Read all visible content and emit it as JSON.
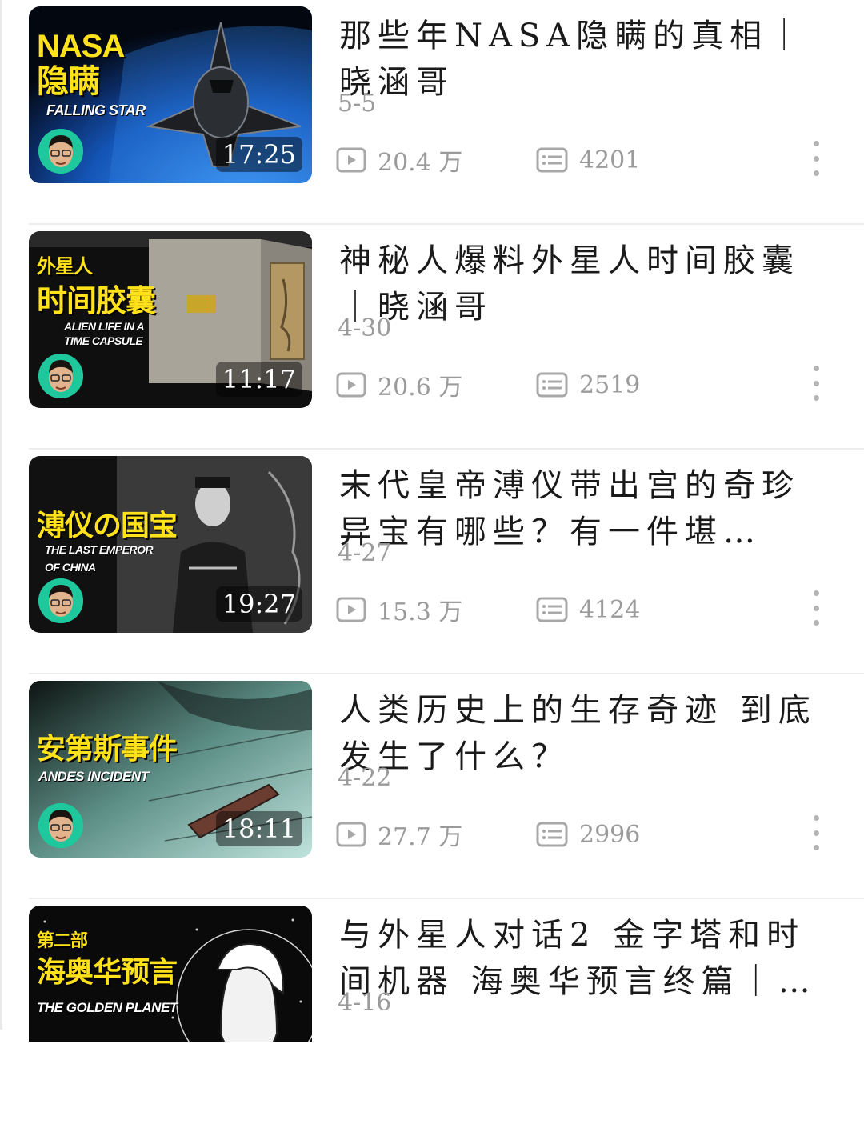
{
  "videos": [
    {
      "title": "那些年NASA隐瞒的真相｜晓涵哥",
      "date": "5-5",
      "views": "20.4 万",
      "comments": "4201",
      "duration": "17:25",
      "thumb_cn": "NASA\n隐瞒",
      "thumb_en": "FALLING STAR"
    },
    {
      "title": "神秘人爆料外星人时间胶囊｜晓涵哥",
      "date": "4-30",
      "views": "20.6 万",
      "comments": "2519",
      "duration": "11:17",
      "thumb_cn_small": "外星人",
      "thumb_cn": "时间胶囊",
      "thumb_en": "ALIEN LIFE IN A\nTIME CAPSULE"
    },
    {
      "title": "末代皇帝溥仪带出宫的奇珍异宝有哪些？有一件堪…",
      "date": "4-27",
      "views": "15.3 万",
      "comments": "4124",
      "duration": "19:27",
      "thumb_cn": "溥仪の国宝",
      "thumb_en": "THE LAST EMPEROR\nOF CHINA"
    },
    {
      "title": "人类历史上的生存奇迹 到底发生了什么？",
      "date": "4-22",
      "views": "27.7 万",
      "comments": "2996",
      "duration": "18:11",
      "thumb_cn": "安第斯事件",
      "thumb_en": "ANDES INCIDENT"
    },
    {
      "title": "与外星人对话2 金字塔和时间机器 海奥华预言终篇｜…",
      "date": "4-16",
      "thumb_cn_small": "第二部",
      "thumb_cn": "海奥华预言",
      "thumb_en": "THE GOLDEN PLANET"
    }
  ],
  "icons": {
    "views": "play-icon",
    "comments": "comment-icon",
    "more": "more-vertical-icon"
  },
  "colors": {
    "title_text": "#1a1a1a",
    "meta_text": "#9b9b9b",
    "thumb_yellow": "#ffe21a",
    "avatar_bg": "#1fc79c"
  }
}
